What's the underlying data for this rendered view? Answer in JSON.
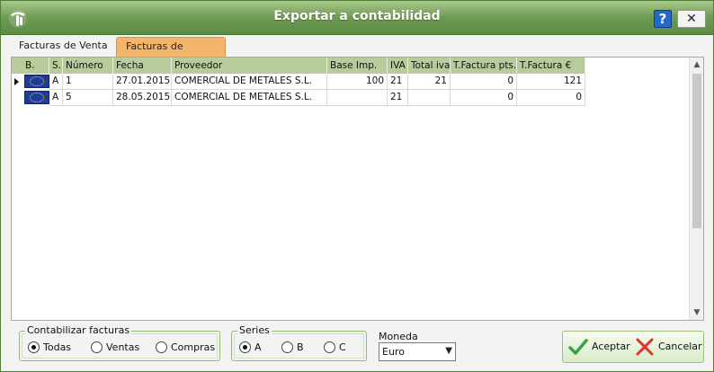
{
  "window": {
    "title": "Exportar a contabilidad",
    "help_label": "?",
    "close_label": "✕"
  },
  "tabs": [
    {
      "label": "Facturas de Venta",
      "active": false
    },
    {
      "label": "Facturas de Compra",
      "active": true
    }
  ],
  "grid": {
    "headers": [
      "B.",
      "S.",
      "Número",
      "Fecha",
      "Proveedor",
      "Base Imp.",
      "IVA",
      "Total iva",
      "T.Factura pts.",
      "T.Factura €"
    ],
    "rows": [
      {
        "serie": "A",
        "numero": "1",
        "fecha": "27.01.2015",
        "proveedor": "COMERCIAL DE METALES S.L.",
        "base": "100",
        "iva": "21",
        "total_iva": "21",
        "t_pts": "0",
        "t_eur": "121",
        "selected": true
      },
      {
        "serie": "A",
        "numero": "5",
        "fecha": "28.05.2015",
        "proveedor": "COMERCIAL DE METALES S.L.",
        "base": "",
        "iva": "21",
        "total_iva": "",
        "t_pts": "0",
        "t_eur": "0",
        "selected": false
      }
    ]
  },
  "contabilizar": {
    "legend": "Contabilizar facturas",
    "options": [
      {
        "label": "Todas",
        "selected": true
      },
      {
        "label": "Ventas",
        "selected": false
      },
      {
        "label": "Compras",
        "selected": false
      }
    ]
  },
  "series": {
    "legend": "Series",
    "options": [
      {
        "label": "A",
        "selected": true
      },
      {
        "label": "B",
        "selected": false
      },
      {
        "label": "C",
        "selected": false
      }
    ]
  },
  "moneda": {
    "label": "Moneda",
    "value": "Euro"
  },
  "actions": {
    "accept_label": "Aceptar",
    "cancel_label": "Cancelar"
  },
  "colors": {
    "title_bar": "#6e9a52",
    "grid_header": "#b8cb9a",
    "active_tab": "#f3b569",
    "accent_green": "#3aa34a",
    "accent_red": "#e0342a"
  }
}
